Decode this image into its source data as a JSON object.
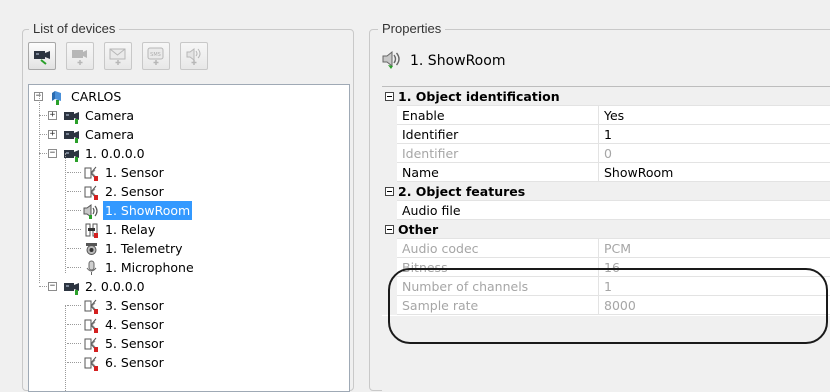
{
  "devices_panel": {
    "title": "List of devices",
    "toolbar": [
      {
        "name": "add-camera-button",
        "icon": "camera-icon",
        "enabled": true
      },
      {
        "name": "add-device-button",
        "icon": "device-add-icon",
        "enabled": false
      },
      {
        "name": "add-mail-button",
        "icon": "mail-add-icon",
        "enabled": false
      },
      {
        "name": "add-sms-button",
        "icon": "sms-add-icon",
        "enabled": false
      },
      {
        "name": "add-speaker-button",
        "icon": "speaker-add-icon",
        "enabled": false
      }
    ],
    "tree": [
      {
        "label": "CARLOS",
        "icon": "computer-icon",
        "level": 0,
        "expander": "minus"
      },
      {
        "label": "Camera",
        "icon": "camera-icon",
        "level": 1,
        "expander": "plus"
      },
      {
        "label": "Camera",
        "icon": "camera-icon",
        "level": 1,
        "expander": "plus"
      },
      {
        "label": "1. 0.0.0.0",
        "icon": "camera-icon",
        "level": 1,
        "expander": "minus"
      },
      {
        "label": "1. Sensor",
        "icon": "sensor-icon",
        "level": 2
      },
      {
        "label": "2. Sensor",
        "icon": "sensor-icon",
        "level": 2
      },
      {
        "label": "1. ShowRoom",
        "icon": "speaker-icon",
        "level": 2,
        "selected": true
      },
      {
        "label": "1. Relay",
        "icon": "relay-icon",
        "level": 2
      },
      {
        "label": "1. Telemetry",
        "icon": "telemetry-icon",
        "level": 2
      },
      {
        "label": "1. Microphone",
        "icon": "microphone-icon",
        "level": 2
      },
      {
        "label": "2. 0.0.0.0",
        "icon": "camera-icon",
        "level": 1,
        "expander": "minus"
      },
      {
        "label": "3. Sensor",
        "icon": "sensor-icon",
        "level": 2
      },
      {
        "label": "4. Sensor",
        "icon": "sensor-icon",
        "level": 2
      },
      {
        "label": "5. Sensor",
        "icon": "sensor-icon",
        "level": 2
      },
      {
        "label": "6. Sensor",
        "icon": "sensor-icon",
        "level": 2
      }
    ]
  },
  "properties_panel": {
    "title": "Properties",
    "object_icon": "speaker-icon",
    "object_name": "1. ShowRoom",
    "rows": [
      {
        "type": "category",
        "label": "1. Object identification"
      },
      {
        "type": "prop",
        "key": "Enable",
        "value": "Yes",
        "disabled": false
      },
      {
        "type": "prop",
        "key": "Identifier",
        "value": "1",
        "disabled": false
      },
      {
        "type": "prop",
        "key": "Identifier",
        "value": "0",
        "disabled": true
      },
      {
        "type": "prop",
        "key": "Name",
        "value": "ShowRoom",
        "disabled": false
      },
      {
        "type": "category",
        "label": "2. Object features"
      },
      {
        "type": "prop",
        "key": "Audio file",
        "value": "",
        "disabled": false
      },
      {
        "type": "category",
        "label": "Other"
      },
      {
        "type": "prop",
        "key": "Audio codec",
        "value": "PCM",
        "disabled": true
      },
      {
        "type": "prop",
        "key": "Bitness",
        "value": "16",
        "disabled": true
      },
      {
        "type": "prop",
        "key": "Number of channels",
        "value": "1",
        "disabled": true
      },
      {
        "type": "prop",
        "key": "Sample rate",
        "value": "8000",
        "disabled": true
      }
    ]
  },
  "colors": {
    "selection": "#3399ff",
    "disabled_text": "#a6a6a6",
    "annotation": "#1a1a1a"
  }
}
